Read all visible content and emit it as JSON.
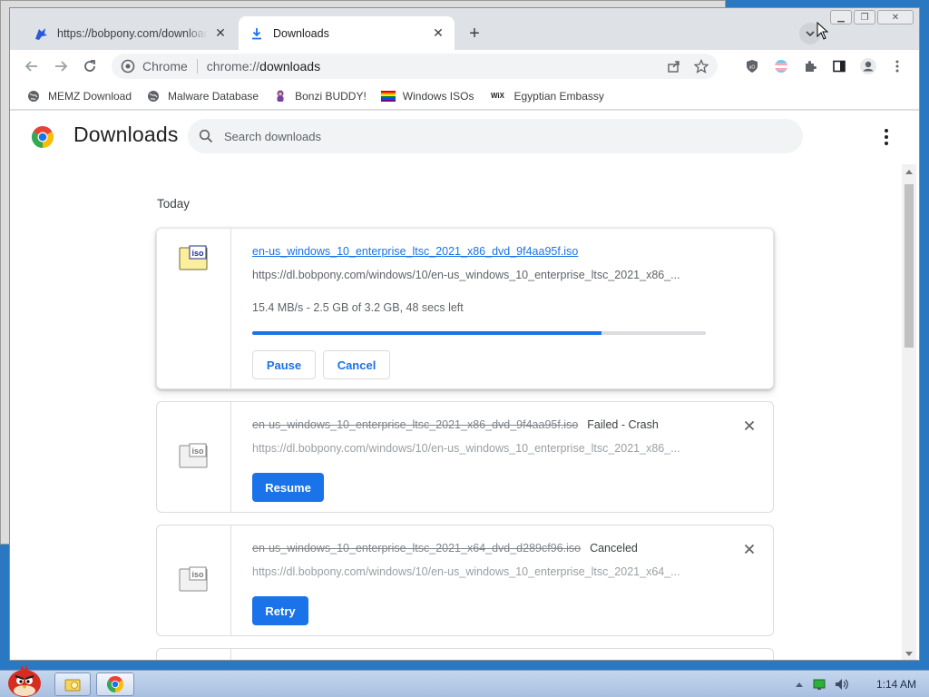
{
  "tabs": [
    {
      "title": "https://bobpony.com/downloads",
      "close": "✕"
    },
    {
      "title": "Downloads",
      "close": "✕"
    }
  ],
  "new_tab": "+",
  "omnibox": {
    "site": "Chrome",
    "url_scheme": "chrome://",
    "url_host": "downloads"
  },
  "bookmarks": [
    {
      "label": "MEMZ Download",
      "icon": "globe-icon"
    },
    {
      "label": "Malware Database",
      "icon": "globe-icon"
    },
    {
      "label": "Bonzi BUDDY!",
      "icon": "bonzi-icon"
    },
    {
      "label": "Windows ISOs",
      "icon": "rainbow-flag-icon"
    },
    {
      "label": "Egyptian Embassy",
      "icon": "wix-icon",
      "icon_text": "WiX"
    }
  ],
  "page": {
    "title": "Downloads",
    "search_placeholder": "Search downloads",
    "date_heading": "Today"
  },
  "downloads": [
    {
      "file_name": "en-us_windows_10_enterprise_ltsc_2021_x86_dvd_9f4aa95f.iso",
      "url": "https://dl.bobpony.com/windows/10/en-us_windows_10_enterprise_ltsc_2021_x86_...",
      "progress_text": "15.4 MB/s - 2.5 GB of 3.2 GB, 48 secs left",
      "progress": 0.77,
      "pause_label": "Pause",
      "cancel_label": "Cancel"
    },
    {
      "file_name": "en-us_windows_10_enterprise_ltsc_2021_x86_dvd_9f4aa95f.iso",
      "status": "Failed - Crash",
      "url": "https://dl.bobpony.com/windows/10/en-us_windows_10_enterprise_ltsc_2021_x86_...",
      "action_label": "Resume"
    },
    {
      "file_name": "en-us_windows_10_enterprise_ltsc_2021_x64_dvd_d289cf96.iso",
      "status": "Canceled",
      "url": "https://dl.bobpony.com/windows/10/en-us_windows_10_enterprise_ltsc_2021_x64_...",
      "action_label": "Retry"
    }
  ],
  "icon_label": "iso",
  "taskbar": {
    "clock": "1:14 AM"
  },
  "colors": {
    "accent": "#1a73e8",
    "progress_track": "#dadce0"
  }
}
